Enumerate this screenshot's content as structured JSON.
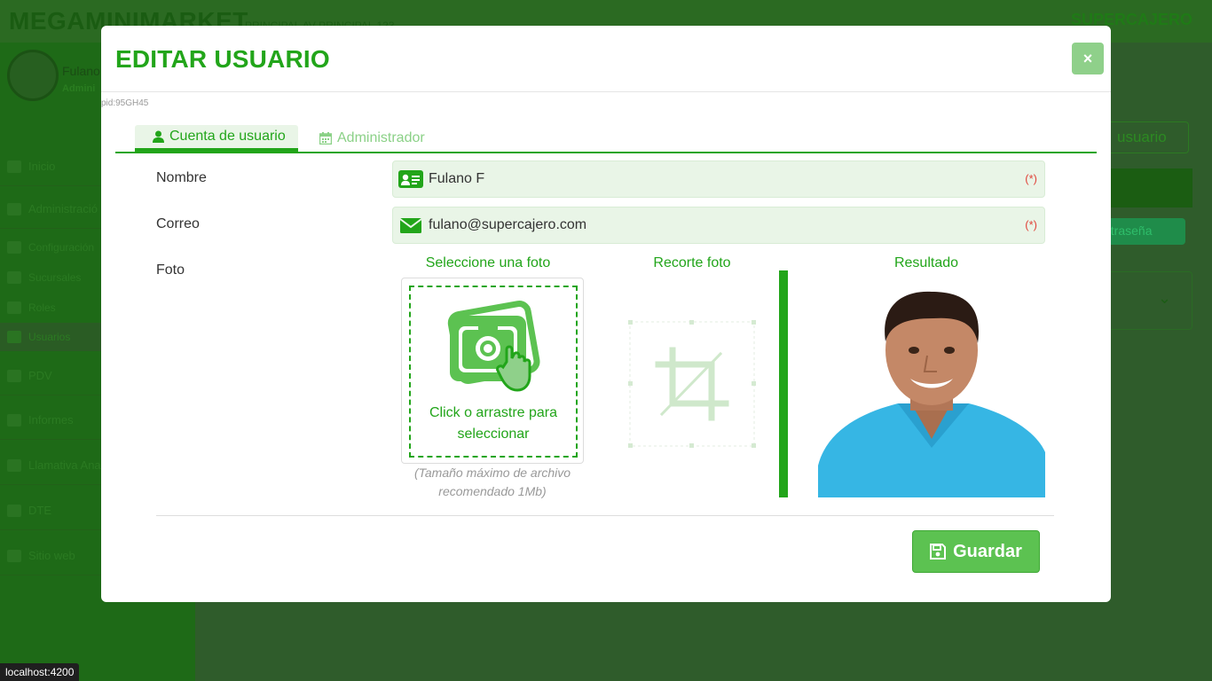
{
  "background": {
    "brand": "MEGAMINIMARKET",
    "branch": "PRINCIPAL   AV PRINCIPAL 123",
    "logo": "SUPERCAJERO",
    "user_name": "Fulano",
    "user_role": "Admini",
    "menu": [
      {
        "label": "Inicio",
        "icon": "home-icon"
      },
      {
        "label": "Administració",
        "icon": "gear-icon"
      },
      {
        "label": "Configuración",
        "icon": "gears-icon"
      },
      {
        "label": "Sucursales",
        "icon": "store-icon"
      },
      {
        "label": "Roles",
        "icon": "mask-icon"
      },
      {
        "label": "Usuarios",
        "icon": "user-circle-icon"
      },
      {
        "label": "PDV",
        "icon": "pos-icon"
      },
      {
        "label": "Informes",
        "icon": "report-icon"
      },
      {
        "label": "Llamativa Ana",
        "icon": "megaphone-icon"
      },
      {
        "label": "DTE",
        "icon": "dte-icon"
      },
      {
        "label": "Sitio web",
        "icon": "cart-icon"
      }
    ],
    "new_user_button": "usuario",
    "password_button": "ntraseña"
  },
  "modal": {
    "title": "EDITAR USUARIO",
    "close_icon": "×",
    "pid": "pid:95GH45",
    "tabs": [
      {
        "label": "Cuenta de usuario",
        "icon": "user-icon",
        "active": true
      },
      {
        "label": "Administrador",
        "icon": "calendar-icon",
        "active": false
      }
    ],
    "form": {
      "name_label": "Nombre",
      "name_value": "Fulano F",
      "email_label": "Correo",
      "email_value": "fulano@supercajero.com",
      "required_mark": "(*)",
      "photo_label": "Foto"
    },
    "photo": {
      "select_title": "Seleccione una foto",
      "crop_title": "Recorte foto",
      "result_title": "Resultado",
      "drop_text_1": "Click o arrastre para",
      "drop_text_2": "seleccionar",
      "hint_1": "(Tamaño máximo de archivo",
      "hint_2": "recomendado 1Mb)"
    },
    "save_button": "Guardar"
  },
  "status_bar": {
    "url": "localhost:4200"
  },
  "colors": {
    "accent": "#22a51a",
    "field_bg": "#e9f5e7",
    "required": "#e0443a",
    "save_bg": "#5cc251"
  }
}
